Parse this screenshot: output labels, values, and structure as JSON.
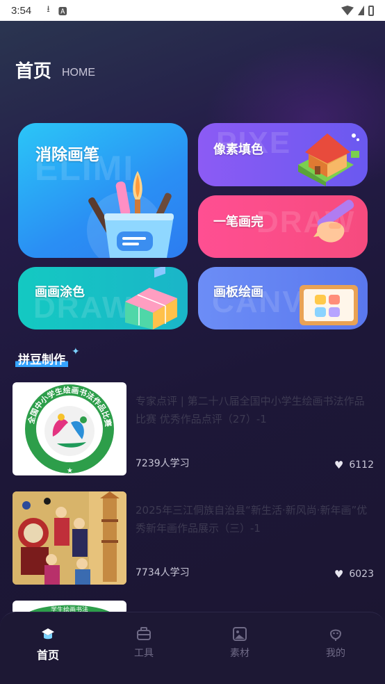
{
  "status_bar": {
    "time": "3:54"
  },
  "header": {
    "title": "首页",
    "subtitle": "HOME"
  },
  "tools": [
    {
      "label": "消除画笔",
      "watermark": "ELIMI"
    },
    {
      "label": "像素填色",
      "watermark": "PIXE"
    },
    {
      "label": "一笔画完",
      "watermark": "DRAW"
    },
    {
      "label": "画画涂色",
      "watermark": "DRAW"
    },
    {
      "label": "画板绘画",
      "watermark": "CANV"
    }
  ],
  "section": {
    "title": "拼豆制作"
  },
  "courses": [
    {
      "title": "专家点评 | 第二十八届全国中小学生绘画书法作品比赛 优秀作品点评（27）-1",
      "learners": "7239人学习",
      "likes": "6112",
      "badge_text": "全国中小学生绘画书法作品比赛"
    },
    {
      "title": "2025年三江侗族自治县“新生活·新风尚·新年画”优秀新年画作品展示（三）-1",
      "learners": "7734人学习",
      "likes": "6023"
    },
    {
      "badge_text": "学生绘画书法"
    }
  ],
  "bottom_nav": [
    {
      "label": "首页",
      "active": true
    },
    {
      "label": "工具"
    },
    {
      "label": "素材"
    },
    {
      "label": "我的"
    }
  ]
}
